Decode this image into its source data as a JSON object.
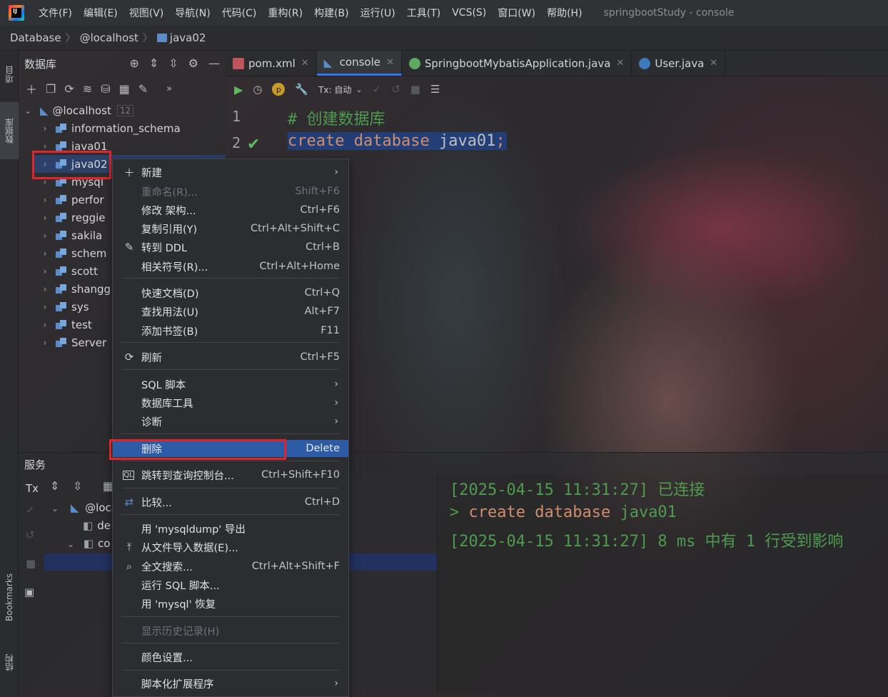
{
  "menubar": {
    "items": [
      "文件(F)",
      "编辑(E)",
      "视图(V)",
      "导航(N)",
      "代码(C)",
      "重构(R)",
      "构建(B)",
      "运行(U)",
      "工具(T)",
      "VCS(S)",
      "窗口(W)",
      "帮助(H)"
    ],
    "window_title": "springbootStudy - console"
  },
  "breadcrumb": [
    "Database",
    "@localhost",
    "java02"
  ],
  "left_strip": {
    "project": "项目",
    "database": "数据库",
    "bookmarks": "Bookmarks",
    "structure": "结构"
  },
  "db_panel": {
    "title": "数据库",
    "host": "@localhost",
    "host_count": "12",
    "schemas": [
      "information_schema",
      "java01",
      "java02",
      "mysql",
      "perfor",
      "reggie",
      "sakila",
      "schem",
      "scott",
      "shangg",
      "sys",
      "test"
    ],
    "server": "Server"
  },
  "tabs": [
    {
      "label": "pom.xml",
      "icon": "maven-icon"
    },
    {
      "label": "console",
      "icon": "console-icon",
      "active": true
    },
    {
      "label": "SpringbootMybatisApplication.java",
      "icon": "spring-icon"
    },
    {
      "label": "User.java",
      "icon": "class-icon"
    }
  ],
  "editor": {
    "tx_label": "Tx: 自动",
    "lines": [
      {
        "num": "1",
        "text": "# 创建数据库"
      },
      {
        "num": "2",
        "kw1": "create",
        "kw2": "database",
        "ident": "java01",
        "semi": ";"
      }
    ]
  },
  "services": {
    "title": "服务",
    "tx": "Tx",
    "host": "@loca",
    "item_de": "de",
    "item_co": "co"
  },
  "console_output": {
    "line1": "[2025-04-15 11:31:27] 已连接",
    "line2_prompt": ">",
    "line2_kw1": "create",
    "line2_kw2": "database",
    "line2_ident": "java01",
    "line3": "[2025-04-15 11:31:27] 8 ms 中有 1 行受到影响"
  },
  "context_menu": {
    "new": "新建",
    "rename": "重命名(R)...",
    "rename_short": "Shift+F6",
    "modify": "修改 架构...",
    "modify_short": "Ctrl+F6",
    "copy_ref": "复制引用(Y)",
    "copy_ref_short": "Ctrl+Alt+Shift+C",
    "goto_ddl": "转到 DDL",
    "goto_ddl_short": "Ctrl+B",
    "related": "相关符号(R)...",
    "related_short": "Ctrl+Alt+Home",
    "quick_doc": "快速文档(D)",
    "quick_doc_short": "Ctrl+Q",
    "find_usages": "查找用法(U)",
    "find_usages_short": "Alt+F7",
    "bookmark": "添加书签(B)",
    "bookmark_short": "F11",
    "refresh": "刷新",
    "refresh_short": "Ctrl+F5",
    "sql_script": "SQL 脚本",
    "db_tools": "数据库工具",
    "diagnose": "诊断",
    "delete": "删除",
    "delete_short": "Delete",
    "jump_console": "跳转到查询控制台...",
    "jump_console_short": "Ctrl+Shift+F10",
    "compare": "比较...",
    "compare_short": "Ctrl+D",
    "mysqldump": "用 'mysqldump' 导出",
    "import_file": "从文件导入数据(E)...",
    "fulltext": "全文搜索...",
    "fulltext_short": "Ctrl+Alt+Shift+F",
    "run_sql": "运行 SQL 脚本...",
    "mysql_restore": "用 'mysql' 恢复",
    "history": "显示历史记录(H)",
    "color": "颜色设置...",
    "scripted_ext": "脚本化扩展程序"
  },
  "colors": {
    "accent": "#3574f0",
    "highlight": "#2e5ba6",
    "redbox": "#e0262b",
    "comment": "#4f9b4f",
    "keyword": "#cf8e6d"
  }
}
